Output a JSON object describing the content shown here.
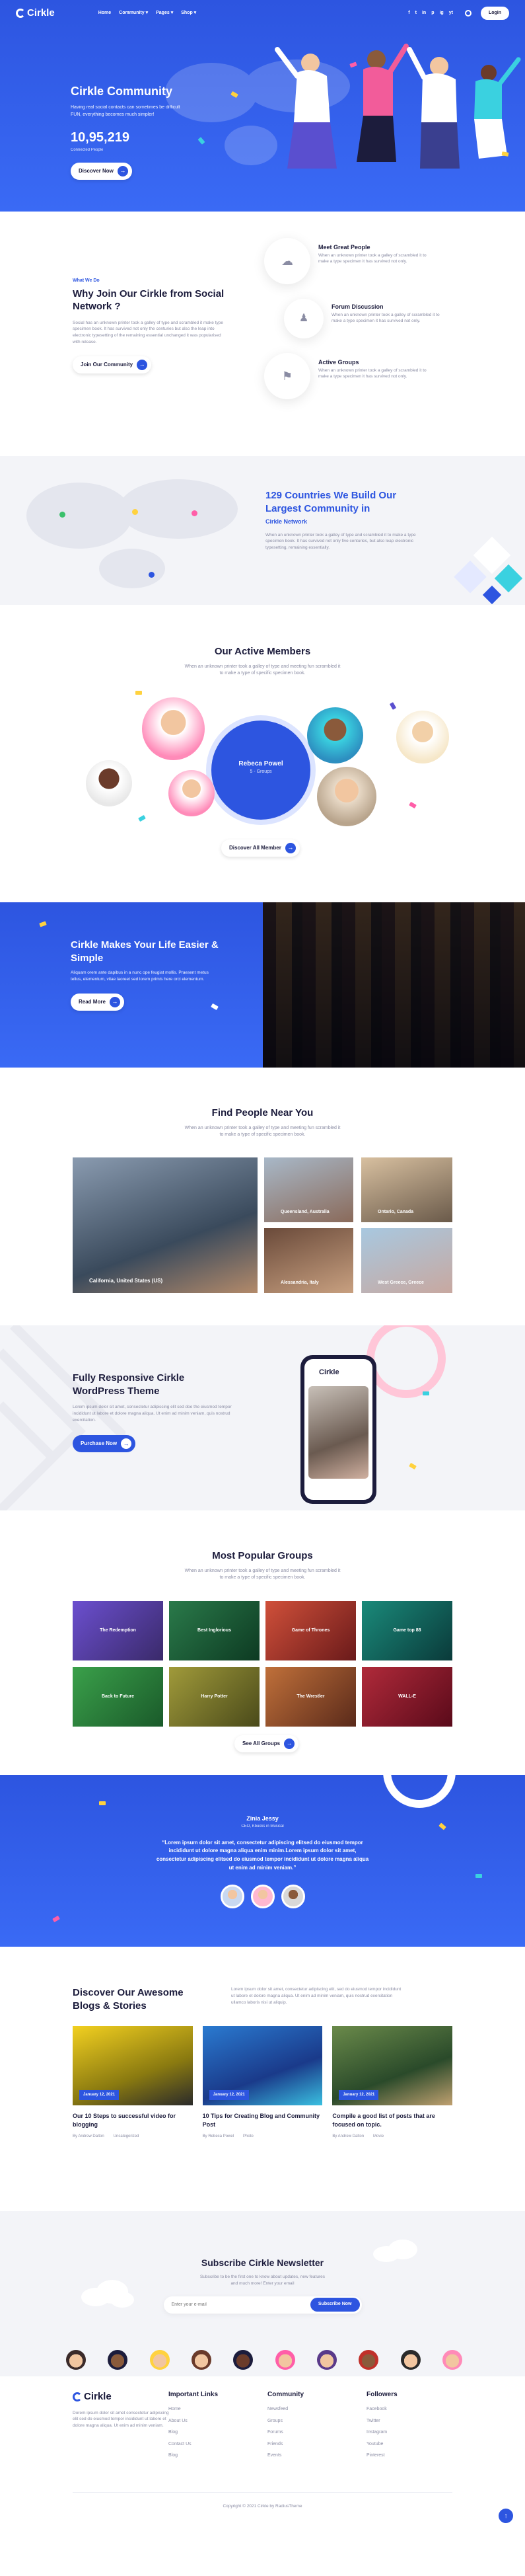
{
  "header": {
    "logo": "Cirkle",
    "nav": [
      "Home",
      "Community ▾",
      "Pages ▾",
      "Shop ▾"
    ],
    "social": [
      "f",
      "t",
      "in",
      "p",
      "ig",
      "yt"
    ],
    "login": "Login"
  },
  "hero": {
    "title": "Cirkle Community",
    "desc": "Having real social contacts can sometimes be difficult FUN, everything becomes much simpler!",
    "count": "10,95,219",
    "count_label": "Connected People",
    "button": "Discover Now"
  },
  "why": {
    "eyebrow": "What We Do",
    "title": "Why Join Our Cirkle from Social Network ?",
    "desc": "Social has an unknown printer took a galley of type and scrambled it make type specimen book. It has survived not only the centuries but also the leap into electronic typesetting of the remaining essential unchanged it was popularised with release.",
    "button": "Join Our Community",
    "features": [
      {
        "title": "Meet Great People",
        "desc": "When an unknown printer took a galley of scrambled it to make a type specimen it has survived not only."
      },
      {
        "title": "Forum Discussion",
        "desc": "When an unknown printer took a galley of scrambled it to make a type specimen it has survived not only."
      },
      {
        "title": "Active Groups",
        "desc": "When an unknown printer took a galley of scrambled it to make a type specimen it has survived not only."
      }
    ]
  },
  "countries": {
    "title": "129 Countries We Build Our Largest Community in",
    "brand": "Cirkle Network",
    "desc": "When an unknown printer took a galley of type and scrambled it to make a type specimen book. It has survived not only five centuries, but also leap electronic typesetting, remaining essentially."
  },
  "members": {
    "title": "Our Active Members",
    "sub": "When an unknown printer took a galley of type and meeting fun scrambled it to make a type of specific specimen book.",
    "featured_name": "Rebeca Powel",
    "featured_groups": "5 - Groups",
    "button": "Discover All Member"
  },
  "easy": {
    "title": "Cirkle Makes Your Life Easier & Simple",
    "desc": "Aliquam orem ante dapibus in a nunc ope feugiat mollis. Praesent metus tellus, elementum, vitae laoreet sed lorem primis here orci elementum.",
    "button": "Read More"
  },
  "near": {
    "title": "Find People Near You",
    "sub": "When an unknown printer took a galley of type and meeting fun scrambled it to make a type of specific specimen book.",
    "places": [
      "California, United States (US)",
      "Queensland, Australia",
      "Ontario, Canada",
      "Alessandria, Italy",
      "West Greece, Greece"
    ]
  },
  "responsive": {
    "title": "Fully Responsive Cirkle WordPress Theme",
    "desc": "Lorem ipsum dolor sit amet, consectetur adipiscing elit sed doe the eiusmod tempor incididunt ut labore et dolore magna aliqua. Ut enim ad minim veniam, quis nostrud exercitation.",
    "button": "Purchase Now",
    "phone_logo": "Cirkle"
  },
  "groups": {
    "title": "Most Popular Groups",
    "sub": "When an unknown printer took a galley of type and meeting fun scrambled it to make a type of specific specimen book.",
    "items": [
      "The Redemption",
      "Best Inglorious",
      "Game of Thrones",
      "Game top 88",
      "Back to Future",
      "Harry Potter",
      "The Wrestler",
      "WALL-E"
    ],
    "button": "See All Groups"
  },
  "testimonial": {
    "name": "Zinia Jessy",
    "role": "CEO, Kbucks in Musical",
    "quote": "“Lorem ipsum dolor sit amet, consectetur adipiscing elitsed do eiusmod tempor incididunt ut dolore magna aliqua enim minim.Lorem ipsum dolor sit amet, consectetur adipiscing elitsed do eiusmod tempor incididunt ut dolore magna aliqua ut enim ad minim veniam.”"
  },
  "blog": {
    "title": "Discover Our Awesome Blogs & Stories",
    "desc": "Lorem ipsum dolor sit amet, consectetur adipiscing elit, sed do eiusmod tempor incididunt ut labore et dolore magna aliqua. Ut enim ad minim veniam, quis nostrud exercitation ullamco laboris nisi ut aliquip.",
    "posts": [
      {
        "date": "January 12, 2021",
        "title": "Our 10 Steps to successful video for blogging",
        "author": "By Andrew Dalton",
        "cat": "Uncategorized"
      },
      {
        "date": "January 12, 2021",
        "title": "10 Tips for Creating Blog and Community Post",
        "author": "By Rebeca Powel",
        "cat": "Photo"
      },
      {
        "date": "January 12, 2021",
        "title": "Compile a good list of posts that are focused on topic.",
        "author": "By Andrew Dalton",
        "cat": "Movie"
      }
    ]
  },
  "newsletter": {
    "title": "Subscribe Cirkle Newsletter",
    "sub": "Subscribe to be the first one to know about updates, new features and much more! Enter your email",
    "placeholder": "Enter your e-mail",
    "button": "Subscribe Now"
  },
  "footer": {
    "logo": "Cirkle",
    "about": "Dorem ipsum dolor sit amet consectetur adipiscing elit sed do eiusmod tempor incididunt ut labore et dolore magna aliqua. Ut enim ad minim veniam.",
    "cols": [
      {
        "title": "Important Links",
        "links": [
          "Home",
          "About Us",
          "Blog",
          "Contact Us",
          "Blog"
        ]
      },
      {
        "title": "Community",
        "links": [
          "Newsfeed",
          "Groups",
          "Forums",
          "Friends",
          "Events"
        ]
      },
      {
        "title": "Followers",
        "links": [
          "Facebook",
          "Twitter",
          "Instagram",
          "Youtube",
          "Pinterest"
        ]
      }
    ],
    "copyright": "Copyright © 2021 Cirkle by RadiusTheme"
  },
  "colors": {
    "primary": "#2d55e0",
    "dark": "#1c1c3c",
    "muted": "#8a8ca3"
  }
}
